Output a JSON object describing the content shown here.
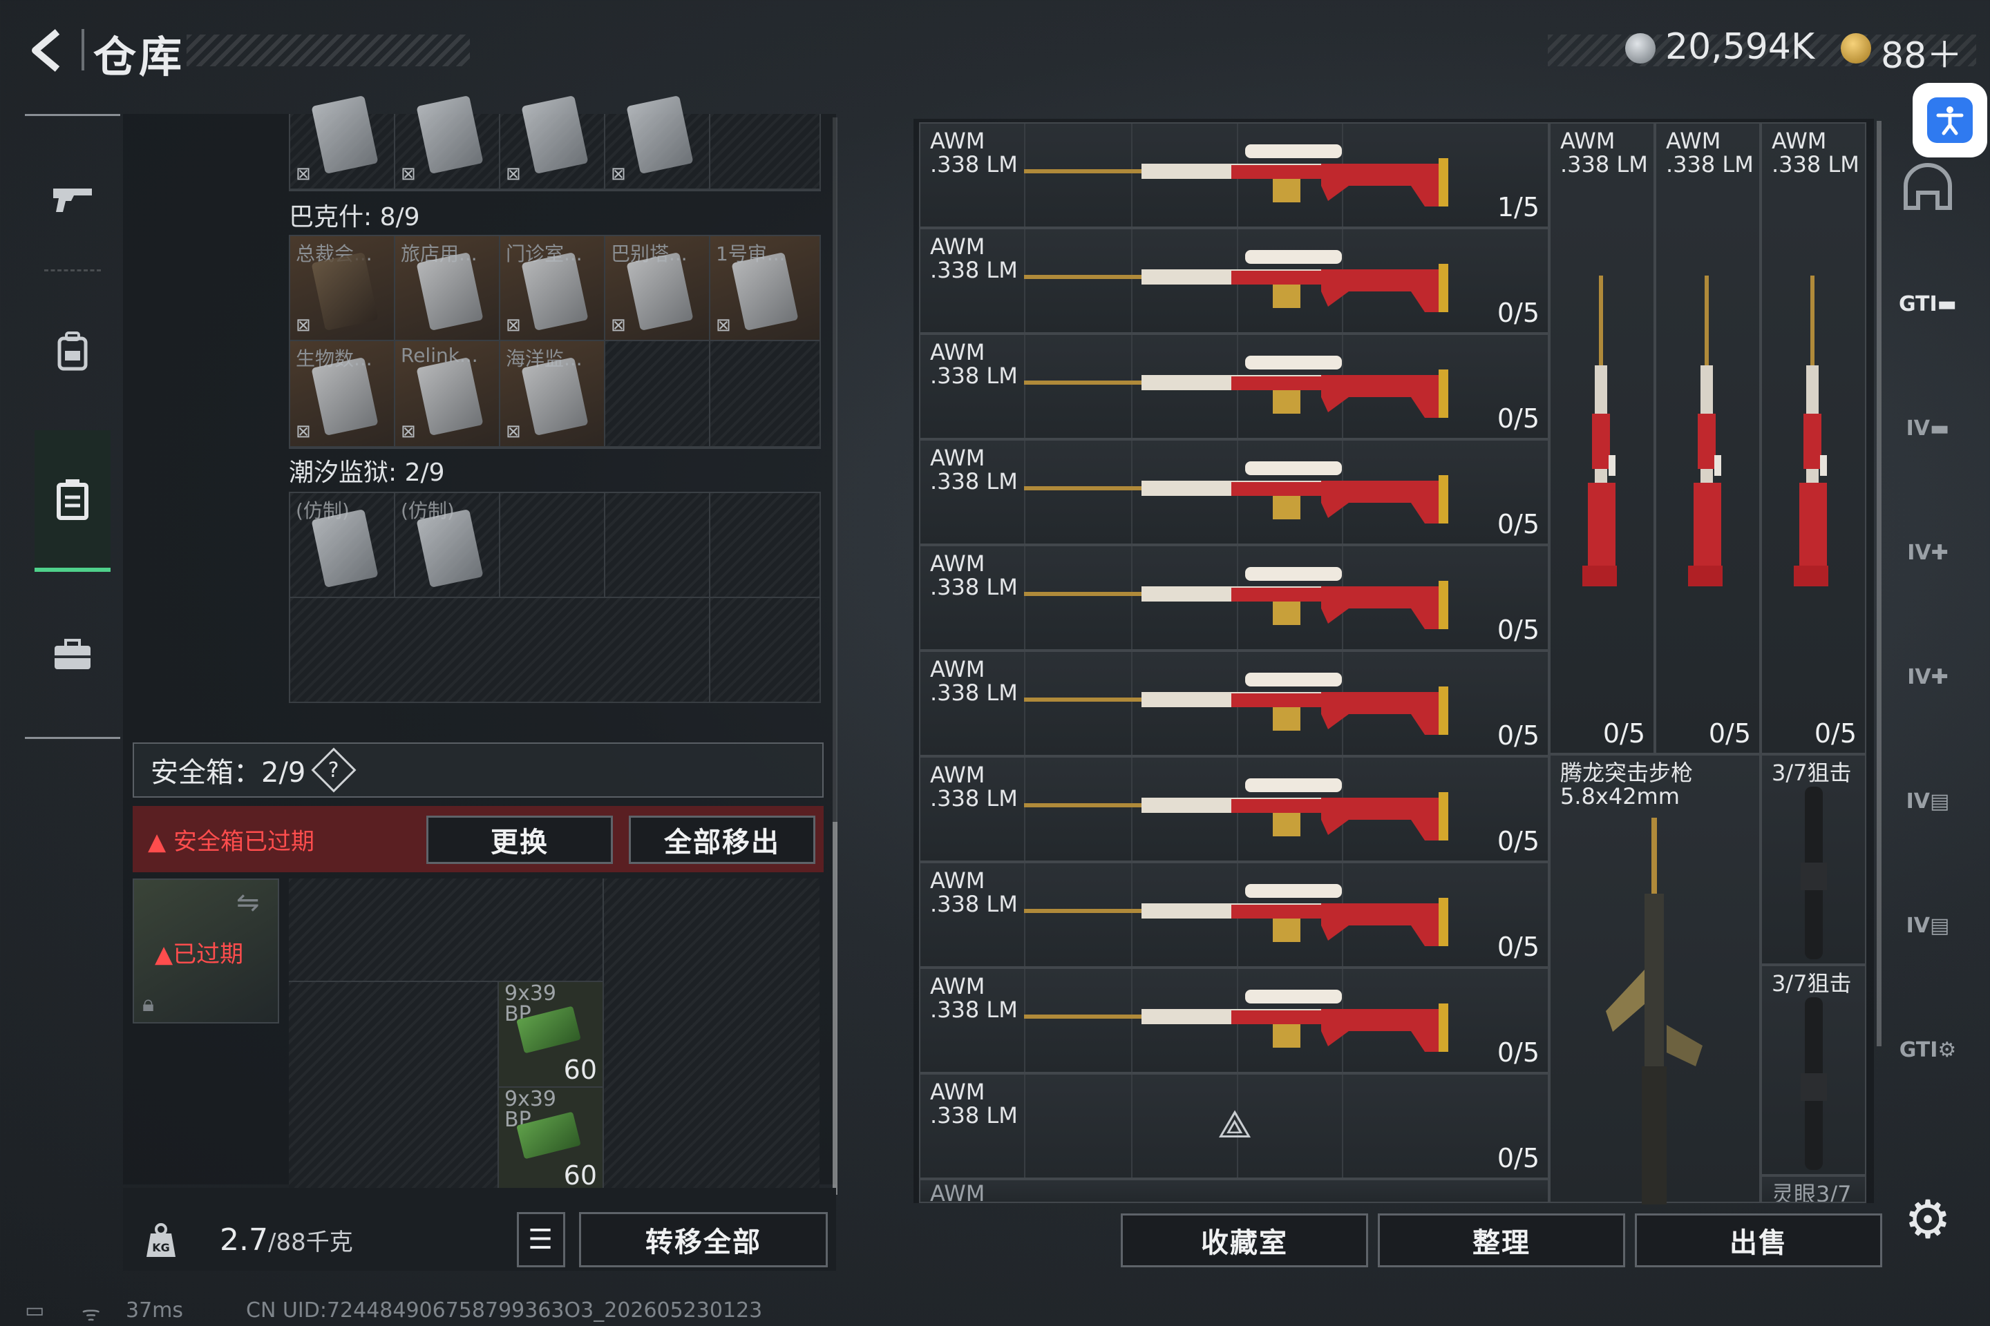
{
  "header": {
    "title": "仓库",
    "currency1": "20,594K",
    "currency2": "88＋"
  },
  "left_nav": [
    "gun-icon",
    "backpack-icon",
    "storage-icon",
    "briefcase-icon"
  ],
  "backpack": {
    "bakesh_label": "巴克什: 8/9",
    "bakesh_cards": [
      "总裁会...",
      "旅店用...",
      "门诊室...",
      "巴别塔...",
      "1号审...",
      "生物数...",
      "Relink...",
      "海洋监..."
    ],
    "tide_label": "潮汐监狱: 2/9",
    "tide_cards": [
      "(仿制)",
      "(仿制)"
    ]
  },
  "safebox": {
    "label": "安全箱：2/9",
    "help": "?",
    "warning": "安全箱已过期",
    "replace_btn": "更换",
    "remove_all_btn": "全部移出",
    "item_status": "已过期",
    "ammo": [
      {
        "name": "9x39\nBP",
        "count": "60"
      },
      {
        "name": "9x39\nBP",
        "count": "60"
      }
    ]
  },
  "bottom": {
    "weight": "2.7",
    "weight_max": "/88千克",
    "transfer_btn": "转移全部",
    "ping": "37ms",
    "uid": "CN UID:724484906758799363O3_202605230123"
  },
  "storage": {
    "rows": [
      {
        "name": "AWM\n.338 LM",
        "count": "1/5"
      },
      {
        "name": "AWM\n.338 LM",
        "count": "0/5"
      },
      {
        "name": "AWM\n.338 LM",
        "count": "0/5"
      },
      {
        "name": "AWM\n.338 LM",
        "count": "0/5"
      },
      {
        "name": "AWM\n.338 LM",
        "count": "0/5"
      },
      {
        "name": "AWM\n.338 LM",
        "count": "0/5"
      },
      {
        "name": "AWM\n.338 LM",
        "count": "0/5"
      },
      {
        "name": "AWM\n.338 LM",
        "count": "0/5"
      },
      {
        "name": "AWM\n.338 LM",
        "count": "0/5"
      },
      {
        "name": "AWM\n.338 LM",
        "count": "0/5"
      }
    ],
    "vertical": [
      {
        "name": "AWM\n.338 LM",
        "count": "0/5"
      },
      {
        "name": "AWM\n.338 LM",
        "count": "0/5"
      },
      {
        "name": "AWM\n.338 LM",
        "count": "0/5"
      }
    ],
    "rifle": {
      "name": "腾龙突击步枪\n5.8x42mm"
    },
    "scopes": [
      {
        "name": "3/7狙击"
      },
      {
        "name": "3/7狙击"
      }
    ],
    "partial_bottom_left": "AWM",
    "partial_bottom_right": "灵眼3/7",
    "buttons": {
      "collection": "收藏室",
      "sort": "整理",
      "sell": "出售"
    }
  },
  "right_icons": [
    "helmet-icon",
    "gti-vehicle-icon",
    "tier4-vehicle-icon",
    "tier4-medkit-icon",
    "tier4-medkit-icon-2",
    "tier4-folder-icon",
    "tier4-folder-icon-2",
    "gti-drone-icon"
  ],
  "colors": {
    "accent_green": "#4fd18b",
    "warn_red": "#ff4d4d",
    "gun_red": "#c0282d"
  }
}
